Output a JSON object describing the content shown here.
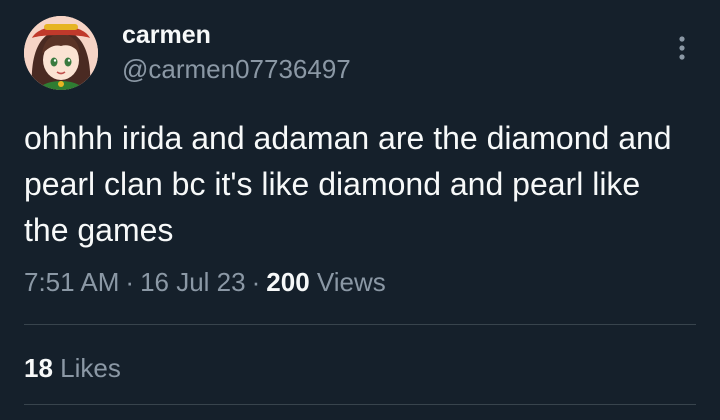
{
  "author": {
    "display_name": "carmen",
    "handle": "@carmen07736497"
  },
  "tweet": {
    "text": "ohhhh irida and adaman are the diamond and pearl clan bc it's like diamond and pearl like the games",
    "time": "7:51 AM",
    "separator": "·",
    "date": "16 Jul 23",
    "views_count": "200",
    "views_label": "Views"
  },
  "stats": {
    "likes_count": "18",
    "likes_label": "Likes"
  },
  "icons": {
    "more": "more-vertical-icon"
  },
  "colors": {
    "background": "#15202b",
    "primary_text": "#f7f9f9",
    "secondary_text": "#8b98a5",
    "divider": "#38444d"
  }
}
